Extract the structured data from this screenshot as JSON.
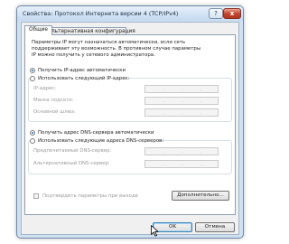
{
  "window": {
    "title": "Свойства: Протокол Интернета версии 4 (TCP/IPv4)",
    "help_label": "?",
    "close_label": "x"
  },
  "tabs": [
    {
      "label": "Общие"
    },
    {
      "label": "Альтернативная конфигурация"
    }
  ],
  "general": {
    "intro": "Параметры IP могут назначаться автоматически, если сеть\nподдерживает эту возможность. В противном случае параметры\nIP можно получить у сетевого администратора.",
    "ip_auto": {
      "label": "Получить IP-адрес автоматически",
      "selected": true
    },
    "ip_manual": {
      "label": "Использовать следующий IP-адрес:",
      "selected": false
    },
    "ip_fields": [
      {
        "label": "IP-адрес:",
        "value": ". . ."
      },
      {
        "label": "Маска подсети:",
        "value": ". . ."
      },
      {
        "label": "Основной шлюз:",
        "value": ". . ."
      }
    ],
    "dns_auto": {
      "label": "Получить адрес DNS-сервера автоматически",
      "selected": true
    },
    "dns_manual": {
      "label": "Использовать следующие адреса DNS-серверов:",
      "selected": false
    },
    "dns_fields": [
      {
        "label": "Предпочитаемый DNS-сервер:",
        "value": ". . ."
      },
      {
        "label": "Альтернативный DNS-сервер:",
        "value": ". . ."
      }
    ],
    "validate_checkbox": {
      "label": "Подтвердить параметры при выходе",
      "checked": false
    },
    "advanced_button": "Дополнительно..."
  },
  "footer": {
    "ok_button": "OK",
    "cancel_button": "Отмена"
  },
  "colors": {
    "accent": "#1d5fb4",
    "close_button": "#c1432d",
    "title_bar": "#c5d9ef"
  }
}
